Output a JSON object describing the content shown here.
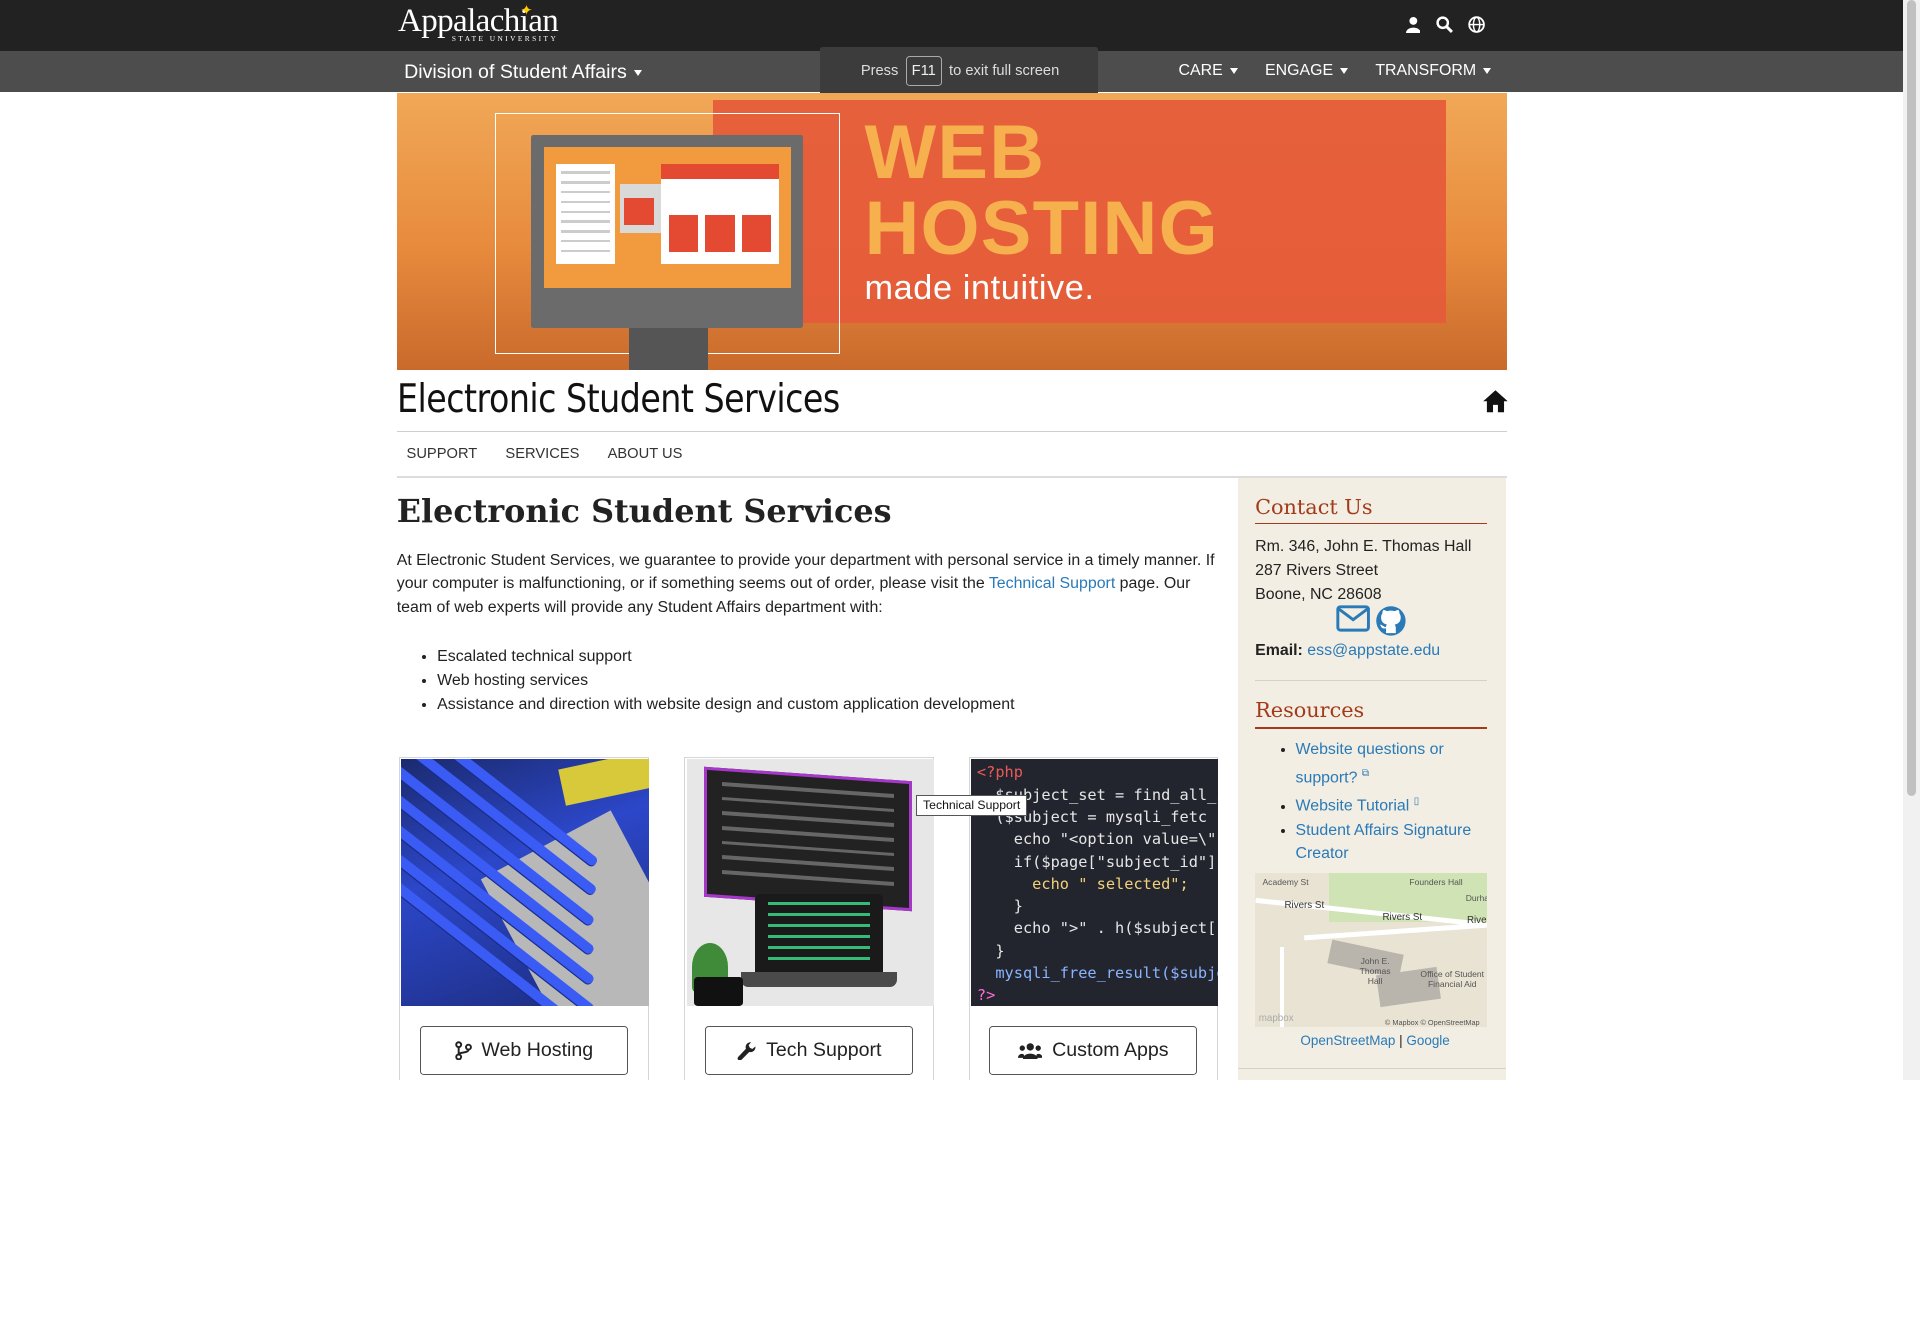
{
  "brand": {
    "logo_main": "Appalachian",
    "logo_sub": "STATE UNIVERSITY"
  },
  "topbar": {
    "icons": [
      "user-icon",
      "search-icon",
      "globe-icon"
    ]
  },
  "division": {
    "title": "Division of Student Affairs",
    "menus": [
      "CARE",
      "ENGAGE",
      "TRANSFORM"
    ]
  },
  "fullscreen_toast": {
    "pre": "Press",
    "key": "F11",
    "post": "to exit full screen"
  },
  "banner": {
    "line1": "WEB",
    "line2": "HOSTING",
    "line3": "made intuitive."
  },
  "site_title": "Electronic Student Services",
  "subnav": [
    "SUPPORT",
    "SERVICES",
    "ABOUT US"
  ],
  "main": {
    "heading": "Electronic Student Services",
    "intro_before": "At Electronic Student Services, we guarantee to provide your department with personal service in a timely manner. If your computer is malfunctioning, or if something seems out of order, please visit the ",
    "intro_link": "Technical Support",
    "intro_after": " page. Our team of web experts will provide any Student Affairs department with:",
    "bullets": [
      "Escalated technical support",
      "Web hosting services",
      "Assistance and direction with website design and custom application development"
    ]
  },
  "cards": [
    {
      "label": "Web Hosting",
      "icon": "code-branch-icon"
    },
    {
      "label": "Tech Support",
      "icon": "wrench-icon"
    },
    {
      "label": "Custom Apps",
      "icon": "users-icon"
    }
  ],
  "code_sample": [
    "<?php",
    "  $subject_set = find_all_subj",
    "  ($subject = mysqli_fetc",
    "    echo \"<option value=\\\"\" .",
    "    if($page[\"subject_id\"] ==",
    "      echo \" selected\";",
    "    }",
    "    echo \">\" . h($subject['men",
    "  }",
    "  mysqli_free_result($subject_",
    "?>"
  ],
  "tooltip": "Technical Support",
  "sidebar": {
    "contact_heading": "Contact Us",
    "address": [
      "Rm. 346, John E. Thomas Hall",
      "287 Rivers Street",
      "Boone, NC 28608"
    ],
    "email_label": "Email:",
    "email": "ess@appstate.edu",
    "resources_heading": "Resources",
    "resources": [
      "Website questions or support?",
      "Website Tutorial",
      "Student Affairs Signature Creator"
    ],
    "map_labels": [
      "Academy St",
      "Founders Hall",
      "Rivers St",
      "Rivers St",
      "Rive",
      "John E. Thomas Hall",
      "Office of Student Financial Aid",
      "Durha",
      "© Mapbox © OpenStreetMap",
      "mapbox"
    ],
    "map_link1": "OpenStreetMap",
    "map_sep": "|",
    "map_link2": "Google"
  },
  "colors": {
    "accent": "#a33b1b",
    "link": "#2a7ab8",
    "topbar": "#222222",
    "divbar": "#4d4d4d",
    "sidebar_bg": "#f2eee3"
  }
}
